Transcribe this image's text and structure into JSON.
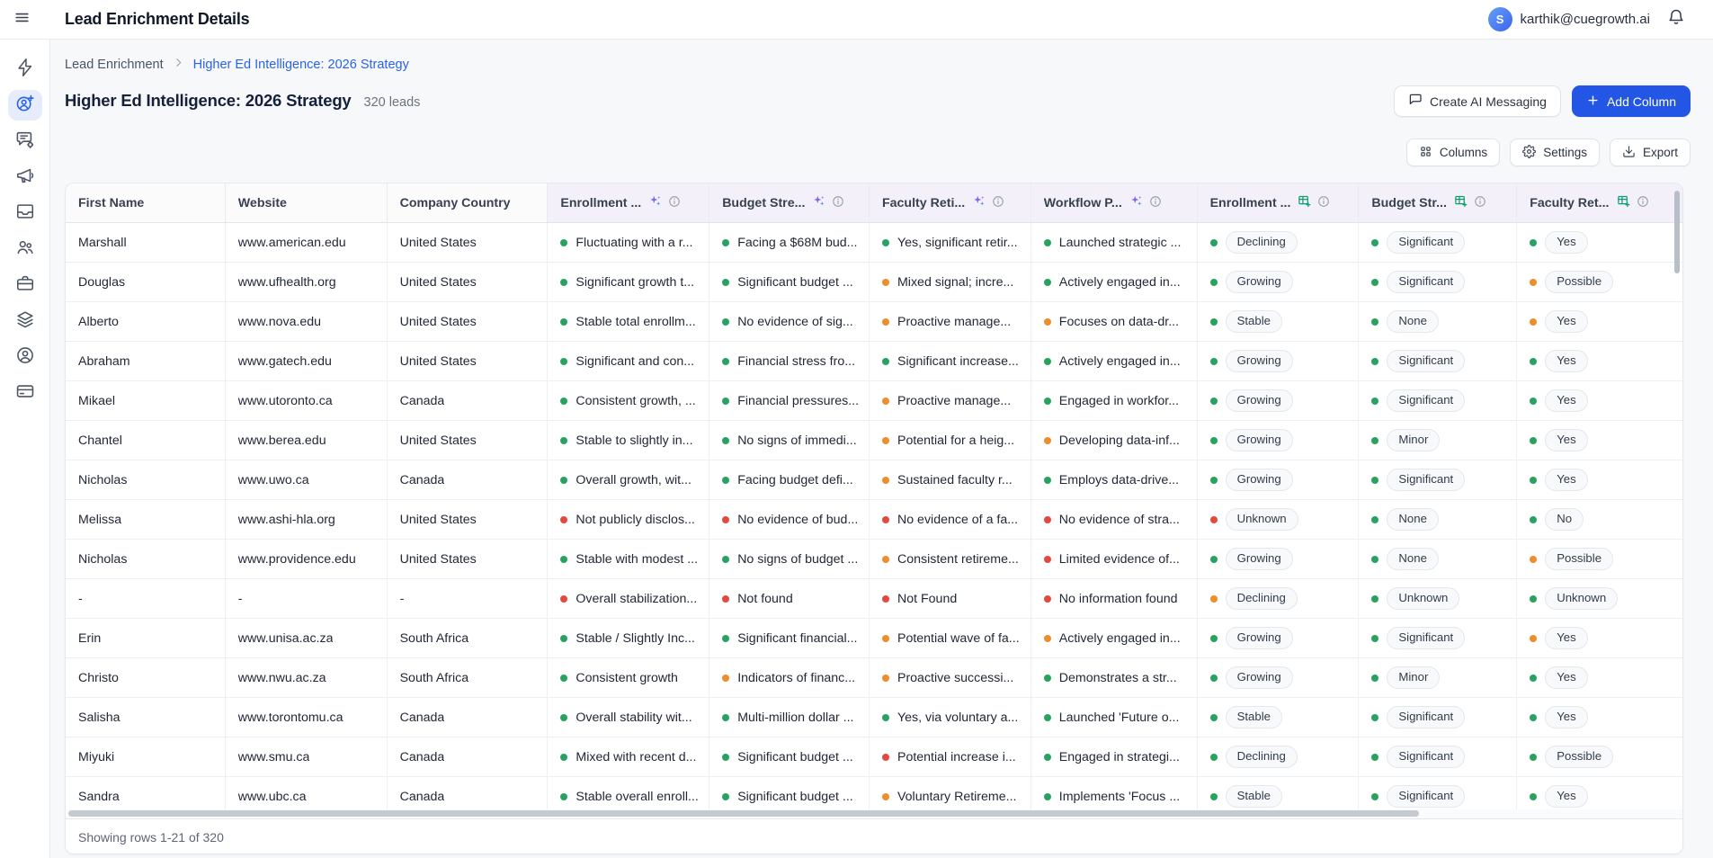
{
  "colors": {
    "accent_blue": "#2356e4",
    "link_blue": "#2b63e8",
    "dot_green": "#27a35f",
    "dot_orange": "#ee8d2c",
    "dot_red": "#e5493d",
    "ai_column_header_bg": "#f3f0fa",
    "sparkle_purple": "#7b68ee",
    "table_icon_green": "#0e9f6e"
  },
  "header": {
    "title": "Lead Enrichment Details",
    "user_email": "karthik@cuegrowth.ai",
    "avatar_letter": "S"
  },
  "sidebar": {
    "items": [
      {
        "icon": "lightning-icon",
        "active": false
      },
      {
        "icon": "enrich-user-plus-icon",
        "active": true
      },
      {
        "icon": "chat-settings-icon",
        "active": false
      },
      {
        "icon": "megaphone-icon",
        "active": false
      },
      {
        "icon": "inbox-icon",
        "active": false
      },
      {
        "icon": "users-icon",
        "active": false
      },
      {
        "icon": "briefcase-icon",
        "active": false
      },
      {
        "icon": "layers-icon",
        "active": false
      },
      {
        "icon": "user-circle-icon",
        "active": false
      },
      {
        "icon": "credit-card-icon",
        "active": false
      }
    ]
  },
  "breadcrumb": {
    "parent": "Lead Enrichment",
    "current": "Higher Ed Intelligence: 2026 Strategy"
  },
  "page": {
    "title": "Higher Ed Intelligence: 2026 Strategy",
    "lead_count": "320 leads"
  },
  "toolbar": {
    "create_ai_messaging": "Create AI Messaging",
    "add_column": "Add Column",
    "columns": "Columns",
    "settings": "Settings",
    "export": "Export"
  },
  "table": {
    "columns": [
      {
        "label": "First Name",
        "type": "plain"
      },
      {
        "label": "Website",
        "type": "plain"
      },
      {
        "label": "Company Country",
        "type": "plain"
      },
      {
        "label": "Enrollment ...",
        "type": "ai"
      },
      {
        "label": "Budget Stre...",
        "type": "ai"
      },
      {
        "label": "Faculty Reti...",
        "type": "ai"
      },
      {
        "label": "Workflow P...",
        "type": "ai"
      },
      {
        "label": "Enrollment ...",
        "type": "formatted"
      },
      {
        "label": "Budget Str...",
        "type": "formatted"
      },
      {
        "label": "Faculty Ret...",
        "type": "formatted"
      }
    ],
    "rows": [
      {
        "cells": [
          {
            "t": "Marshall"
          },
          {
            "t": "www.american.edu"
          },
          {
            "t": "United States"
          },
          {
            "t": "Fluctuating with a r...",
            "dot": "green"
          },
          {
            "t": "Facing a $68M bud...",
            "dot": "green"
          },
          {
            "t": "Yes, significant retir...",
            "dot": "green"
          },
          {
            "t": "Launched strategic ...",
            "dot": "green"
          },
          {
            "t": "Declining",
            "dot": "green",
            "badge": true
          },
          {
            "t": "Significant",
            "dot": "green",
            "badge": true
          },
          {
            "t": "Yes",
            "dot": "green",
            "badge": true
          }
        ]
      },
      {
        "cells": [
          {
            "t": "Douglas"
          },
          {
            "t": "www.ufhealth.org"
          },
          {
            "t": "United States"
          },
          {
            "t": "Significant growth t...",
            "dot": "green"
          },
          {
            "t": "Significant budget ...",
            "dot": "green"
          },
          {
            "t": "Mixed signal; incre...",
            "dot": "orange"
          },
          {
            "t": "Actively engaged in...",
            "dot": "green"
          },
          {
            "t": "Growing",
            "dot": "green",
            "badge": true
          },
          {
            "t": "Significant",
            "dot": "green",
            "badge": true
          },
          {
            "t": "Possible",
            "dot": "orange",
            "badge": true
          }
        ]
      },
      {
        "cells": [
          {
            "t": "Alberto"
          },
          {
            "t": "www.nova.edu"
          },
          {
            "t": "United States"
          },
          {
            "t": "Stable total enrollm...",
            "dot": "green"
          },
          {
            "t": "No evidence of sig...",
            "dot": "green"
          },
          {
            "t": "Proactive manage...",
            "dot": "orange"
          },
          {
            "t": "Focuses on data-dr...",
            "dot": "orange"
          },
          {
            "t": "Stable",
            "dot": "green",
            "badge": true
          },
          {
            "t": "None",
            "dot": "green",
            "badge": true
          },
          {
            "t": "Yes",
            "dot": "orange",
            "badge": true
          }
        ]
      },
      {
        "cells": [
          {
            "t": "Abraham"
          },
          {
            "t": "www.gatech.edu"
          },
          {
            "t": "United States"
          },
          {
            "t": "Significant and con...",
            "dot": "green"
          },
          {
            "t": "Financial stress fro...",
            "dot": "green"
          },
          {
            "t": "Significant increase...",
            "dot": "green"
          },
          {
            "t": "Actively engaged in...",
            "dot": "green"
          },
          {
            "t": "Growing",
            "dot": "green",
            "badge": true
          },
          {
            "t": "Significant",
            "dot": "green",
            "badge": true
          },
          {
            "t": "Yes",
            "dot": "green",
            "badge": true
          }
        ]
      },
      {
        "cells": [
          {
            "t": "Mikael"
          },
          {
            "t": "www.utoronto.ca"
          },
          {
            "t": "Canada"
          },
          {
            "t": "Consistent growth, ...",
            "dot": "green"
          },
          {
            "t": "Financial pressures...",
            "dot": "green"
          },
          {
            "t": "Proactive manage...",
            "dot": "orange"
          },
          {
            "t": "Engaged in workfor...",
            "dot": "green"
          },
          {
            "t": "Growing",
            "dot": "green",
            "badge": true
          },
          {
            "t": "Significant",
            "dot": "green",
            "badge": true
          },
          {
            "t": "Yes",
            "dot": "green",
            "badge": true
          }
        ]
      },
      {
        "cells": [
          {
            "t": "Chantel"
          },
          {
            "t": "www.berea.edu"
          },
          {
            "t": "United States"
          },
          {
            "t": "Stable to slightly in...",
            "dot": "green"
          },
          {
            "t": "No signs of immedi...",
            "dot": "green"
          },
          {
            "t": "Potential for a heig...",
            "dot": "orange"
          },
          {
            "t": "Developing data-inf...",
            "dot": "orange"
          },
          {
            "t": "Growing",
            "dot": "green",
            "badge": true
          },
          {
            "t": "Minor",
            "dot": "green",
            "badge": true
          },
          {
            "t": "Yes",
            "dot": "green",
            "badge": true
          }
        ]
      },
      {
        "cells": [
          {
            "t": "Nicholas"
          },
          {
            "t": "www.uwo.ca"
          },
          {
            "t": "Canada"
          },
          {
            "t": "Overall growth, wit...",
            "dot": "green"
          },
          {
            "t": "Facing budget defi...",
            "dot": "green"
          },
          {
            "t": "Sustained faculty r...",
            "dot": "orange"
          },
          {
            "t": "Employs data-drive...",
            "dot": "green"
          },
          {
            "t": "Growing",
            "dot": "green",
            "badge": true
          },
          {
            "t": "Significant",
            "dot": "green",
            "badge": true
          },
          {
            "t": "Yes",
            "dot": "green",
            "badge": true
          }
        ]
      },
      {
        "cells": [
          {
            "t": "Melissa"
          },
          {
            "t": "www.ashi-hla.org"
          },
          {
            "t": "United States"
          },
          {
            "t": "Not publicly disclos...",
            "dot": "red"
          },
          {
            "t": "No evidence of bud...",
            "dot": "red"
          },
          {
            "t": "No evidence of a fa...",
            "dot": "red"
          },
          {
            "t": "No evidence of stra...",
            "dot": "red"
          },
          {
            "t": "Unknown",
            "dot": "red",
            "badge": true
          },
          {
            "t": "None",
            "dot": "green",
            "badge": true
          },
          {
            "t": "No",
            "dot": "green",
            "badge": true
          }
        ]
      },
      {
        "cells": [
          {
            "t": "Nicholas"
          },
          {
            "t": "www.providence.edu"
          },
          {
            "t": "United States"
          },
          {
            "t": "Stable with modest ...",
            "dot": "green"
          },
          {
            "t": "No signs of budget ...",
            "dot": "green"
          },
          {
            "t": "Consistent retireme...",
            "dot": "orange"
          },
          {
            "t": "Limited evidence of...",
            "dot": "red"
          },
          {
            "t": "Growing",
            "dot": "green",
            "badge": true
          },
          {
            "t": "None",
            "dot": "green",
            "badge": true
          },
          {
            "t": "Possible",
            "dot": "orange",
            "badge": true
          }
        ]
      },
      {
        "cells": [
          {
            "t": "-"
          },
          {
            "t": "-"
          },
          {
            "t": "-"
          },
          {
            "t": "Overall stabilization...",
            "dot": "red"
          },
          {
            "t": "Not found",
            "dot": "red"
          },
          {
            "t": "Not Found",
            "dot": "red"
          },
          {
            "t": "No information found",
            "dot": "red"
          },
          {
            "t": "Declining",
            "dot": "orange",
            "badge": true
          },
          {
            "t": "Unknown",
            "dot": "green",
            "badge": true
          },
          {
            "t": "Unknown",
            "dot": "green",
            "badge": true
          }
        ]
      },
      {
        "cells": [
          {
            "t": "Erin"
          },
          {
            "t": "www.unisa.ac.za"
          },
          {
            "t": "South Africa"
          },
          {
            "t": "Stable / Slightly Inc...",
            "dot": "green"
          },
          {
            "t": "Significant financial...",
            "dot": "green"
          },
          {
            "t": "Potential wave of fa...",
            "dot": "orange"
          },
          {
            "t": "Actively engaged in...",
            "dot": "orange"
          },
          {
            "t": "Growing",
            "dot": "green",
            "badge": true
          },
          {
            "t": "Significant",
            "dot": "green",
            "badge": true
          },
          {
            "t": "Yes",
            "dot": "orange",
            "badge": true
          }
        ]
      },
      {
        "cells": [
          {
            "t": "Christo"
          },
          {
            "t": "www.nwu.ac.za"
          },
          {
            "t": "South Africa"
          },
          {
            "t": "Consistent growth",
            "dot": "green"
          },
          {
            "t": "Indicators of financ...",
            "dot": "orange"
          },
          {
            "t": "Proactive successi...",
            "dot": "orange"
          },
          {
            "t": "Demonstrates a str...",
            "dot": "green"
          },
          {
            "t": "Growing",
            "dot": "green",
            "badge": true
          },
          {
            "t": "Minor",
            "dot": "green",
            "badge": true
          },
          {
            "t": "Yes",
            "dot": "green",
            "badge": true
          }
        ]
      },
      {
        "cells": [
          {
            "t": "Salisha"
          },
          {
            "t": "www.torontomu.ca"
          },
          {
            "t": "Canada"
          },
          {
            "t": "Overall stability wit...",
            "dot": "green"
          },
          {
            "t": "Multi-million dollar ...",
            "dot": "green"
          },
          {
            "t": "Yes, via voluntary a...",
            "dot": "green"
          },
          {
            "t": "Launched 'Future o...",
            "dot": "green"
          },
          {
            "t": "Stable",
            "dot": "green",
            "badge": true
          },
          {
            "t": "Significant",
            "dot": "green",
            "badge": true
          },
          {
            "t": "Yes",
            "dot": "green",
            "badge": true
          }
        ]
      },
      {
        "cells": [
          {
            "t": "Miyuki"
          },
          {
            "t": "www.smu.ca"
          },
          {
            "t": "Canada"
          },
          {
            "t": "Mixed with recent d...",
            "dot": "green"
          },
          {
            "t": "Significant budget ...",
            "dot": "green"
          },
          {
            "t": "Potential increase i...",
            "dot": "red"
          },
          {
            "t": "Engaged in strategi...",
            "dot": "green"
          },
          {
            "t": "Declining",
            "dot": "green",
            "badge": true
          },
          {
            "t": "Significant",
            "dot": "green",
            "badge": true
          },
          {
            "t": "Possible",
            "dot": "green",
            "badge": true
          }
        ]
      },
      {
        "cells": [
          {
            "t": "Sandra"
          },
          {
            "t": "www.ubc.ca"
          },
          {
            "t": "Canada"
          },
          {
            "t": "Stable overall enroll...",
            "dot": "green"
          },
          {
            "t": "Significant budget ...",
            "dot": "green"
          },
          {
            "t": "Voluntary Retireme...",
            "dot": "orange"
          },
          {
            "t": "Implements 'Focus ...",
            "dot": "green"
          },
          {
            "t": "Stable",
            "dot": "green",
            "badge": true
          },
          {
            "t": "Significant",
            "dot": "green",
            "badge": true
          },
          {
            "t": "Yes",
            "dot": "green",
            "badge": true
          }
        ]
      }
    ]
  },
  "footer": {
    "status": "Showing rows 1-21 of 320"
  }
}
